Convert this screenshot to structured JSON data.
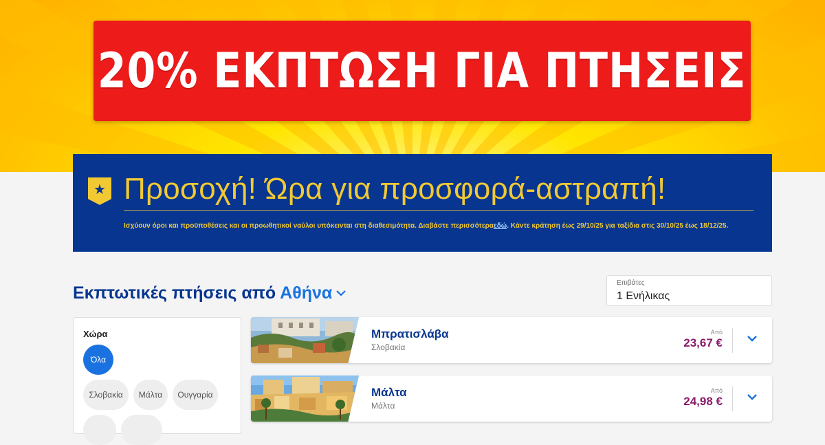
{
  "hero": {
    "banner_text": "20% ΕΚΠΤΩΣΗ ΓΙΑ ΠΤΗΣΕΙΣ"
  },
  "flash_sale": {
    "title": "Προσοχή! Ώρα για προσφορά-αστραπή!",
    "terms_text": "Ισχύουν όροι και προϋποθέσεις και οι προωθητικοί ναύλοι υπόκεινται στη διαθεσιμότητα. Διαβάστε περισσότερα",
    "terms_link": "εδώ",
    "terms_tail": ". Κάντε κράτηση έως 29/10/25 για ταξίδια στις 30/10/25 έως 18/12/25.",
    "icon": "star-shield-icon"
  },
  "section": {
    "title_prefix": "Εκπτωτικές πτήσεις από",
    "city": "Αθήνα"
  },
  "passengers": {
    "label": "Επιβάτες",
    "value": "1 Ενήλικας"
  },
  "filter": {
    "title": "Χώρα",
    "chips": [
      "Όλα",
      "Σλοβακία",
      "Μάλτα",
      "Ουγγαρία"
    ],
    "active": "Όλα"
  },
  "destinations": [
    {
      "name": "Μπρατισλάβα",
      "country": "Σλοβακία",
      "from_label": "Από",
      "price": "23,67 €"
    },
    {
      "name": "Μάλτα",
      "country": "Μάλτα",
      "from_label": "Από",
      "price": "24,98 €"
    }
  ],
  "colors": {
    "brand_blue": "#073590",
    "accent_yellow": "#f1c933",
    "link_blue": "#1972e0",
    "price_purple": "#8a1b6a",
    "banner_red": "#ee1b1b"
  }
}
